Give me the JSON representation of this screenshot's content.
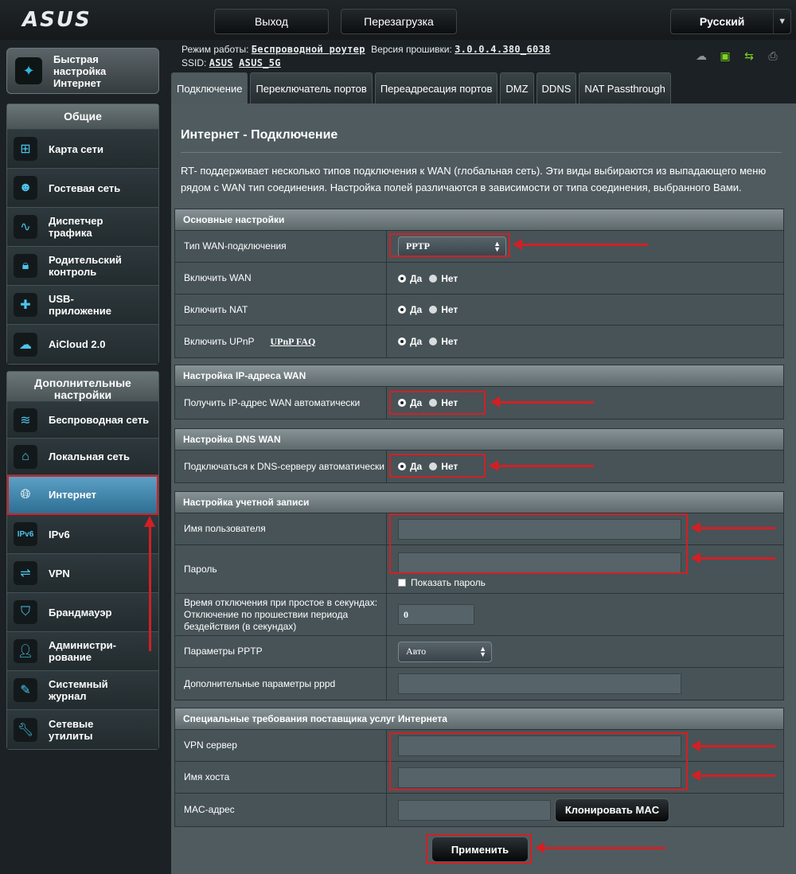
{
  "header": {
    "logo": "ASUS",
    "logout_label": "Выход",
    "reboot_label": "Перезагрузка",
    "language": "Русский"
  },
  "status": {
    "mode_label": "Режим работы:",
    "mode_value": "Беспроводной роутер",
    "firmware_label": "Версия прошивки:",
    "firmware_value": "3.0.0.4.380_6038",
    "ssid_label": "SSID:",
    "ssid_1": "ASUS",
    "ssid_2": "ASUS_5G"
  },
  "sidebar": {
    "quick_setup": "Быстрая настройка Интернет",
    "general_header": "Общие",
    "general_items": [
      {
        "label": "Карта сети",
        "icon": "network-map-icon"
      },
      {
        "label": "Гостевая сеть",
        "icon": "guest-network-icon"
      },
      {
        "label": "Диспетчер трафика",
        "icon": "traffic-manager-icon"
      },
      {
        "label": "Родительский контроль",
        "icon": "lock-icon"
      },
      {
        "label": "USB-приложение",
        "icon": "puzzle-icon"
      },
      {
        "label": "AiCloud 2.0",
        "icon": "cloud-icon"
      }
    ],
    "advanced_header": "Дополнительные настройки",
    "advanced_items": [
      {
        "label": "Беспроводная сеть",
        "icon": "wifi-icon"
      },
      {
        "label": "Локальная сеть",
        "icon": "home-icon"
      },
      {
        "label": "Интернет",
        "icon": "globe-icon"
      },
      {
        "label": "IPv6",
        "icon": "ipv6-icon"
      },
      {
        "label": "VPN",
        "icon": "vpn-icon"
      },
      {
        "label": "Брандмауэр",
        "icon": "shield-icon"
      },
      {
        "label": "Администри-рование",
        "icon": "admin-user-icon"
      },
      {
        "label": "Системный журнал",
        "icon": "log-icon"
      },
      {
        "label": "Сетевые утилиты",
        "icon": "wrench-icon"
      }
    ]
  },
  "tabs": [
    "Подключение",
    "Переключатель портов",
    "Переадресация портов",
    "DMZ",
    "DDNS",
    "NAT Passthrough"
  ],
  "page": {
    "title": "Интернет - Подключение",
    "description": "RT-          поддерживает несколько типов подключения к WAN (глобальная сеть). Эти виды выбираются из выпадающего меню рядом с WAN тип соединения. Настройка полей различаются в зависимости от типа соединения, выбранного Вами."
  },
  "basic": {
    "header": "Основные настройки",
    "wan_type_label": "Тип WAN-подключения",
    "wan_type_value": "PPTP",
    "enable_wan_label": "Включить WAN",
    "enable_nat_label": "Включить NAT",
    "enable_upnp_label": "Включить UPnP",
    "upnp_faq": "UPnP FAQ",
    "yes": "Да",
    "no": "Нет"
  },
  "wan_ip": {
    "header": "Настройка IP-адреса WAN",
    "auto_ip_label": "Получить IP-адрес WAN автоматически"
  },
  "wan_dns": {
    "header": "Настройка DNS WAN",
    "auto_dns_label": "Подключаться к DNS-серверу автоматически"
  },
  "account": {
    "header": "Настройка учетной записи",
    "username_label": "Имя пользователя",
    "password_label": "Пароль",
    "show_password": "Показать пароль",
    "idle_label": "Время отключения при простое в секундах: Отключение по прошествии периода бездействия (в секундах)",
    "idle_value": "0",
    "pptp_options_label": "Параметры PPTP",
    "pptp_options_value": "Авто",
    "pppd_label": "Дополнительные параметры pppd"
  },
  "isp": {
    "header": "Специальные требования поставщика услуг Интернета",
    "vpn_server_label": "VPN сервер",
    "hostname_label": "Имя хоста",
    "mac_label": "MAC-адрес",
    "clone_mac": "Клонировать MAC"
  },
  "apply_label": "Применить",
  "colors": {
    "annotation_red": "#d12025",
    "active_nav": "#3f86ad",
    "panel": "#4f5b5f"
  }
}
